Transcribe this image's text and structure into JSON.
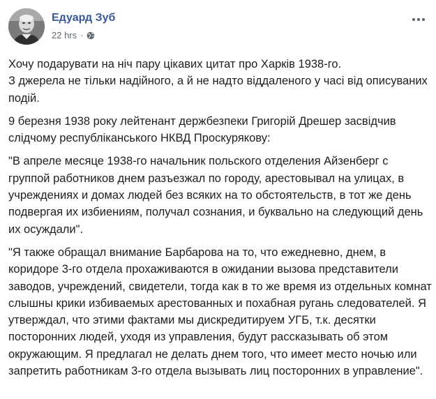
{
  "post": {
    "author_name": "Едуард Зуб",
    "timestamp": "22 hrs",
    "separator": "·",
    "privacy_icon": "globe-icon",
    "more_icon": "more-horizontal-icon",
    "link_color": "#385898",
    "paragraphs": [
      "Хочу подарувати на ніч пару цікавих цитат про Харків 1938-го.\nЗ джерела не тільки надійного, а й не надто віддаленого у часі від описуваних подій.",
      "9 березня 1938 року лейтенант держбезпеки Григорій Дрешер засвідчив слідчому республіканського НКВД Проскурякову:",
      "\"В апреле месяце 1938-го начальник польского отделения Айзенберг с группой работников днем разъезжал по городу, арестовывал на улицах, в учреждениях и домах людей без всяких на то обстоятельств, в тот же день подвергая их избиениям, получал сознания, и буквально на следующий день их осуждали\".",
      "\"Я также обращал внимание Барбарова на то, что ежедневно, днем, в коридоре 3-го отдела прохаживаются в ожидании вызова представители заводов, учреждений, свидетели, тогда как в то же время из отдельных комнат слышны крики избиваемых арестованных и похабная ругань следователей. Я утверждал, что этими фактами мы дискредитируем УГБ, т.к. десятки посторонних людей, уходя из управления, будут рассказывать об этом окружающим. Я предлагал не делать днем того, что имеет место ночью или запретить работникам 3-го отдела вызывать лиц посторонних в управление\"."
    ]
  }
}
